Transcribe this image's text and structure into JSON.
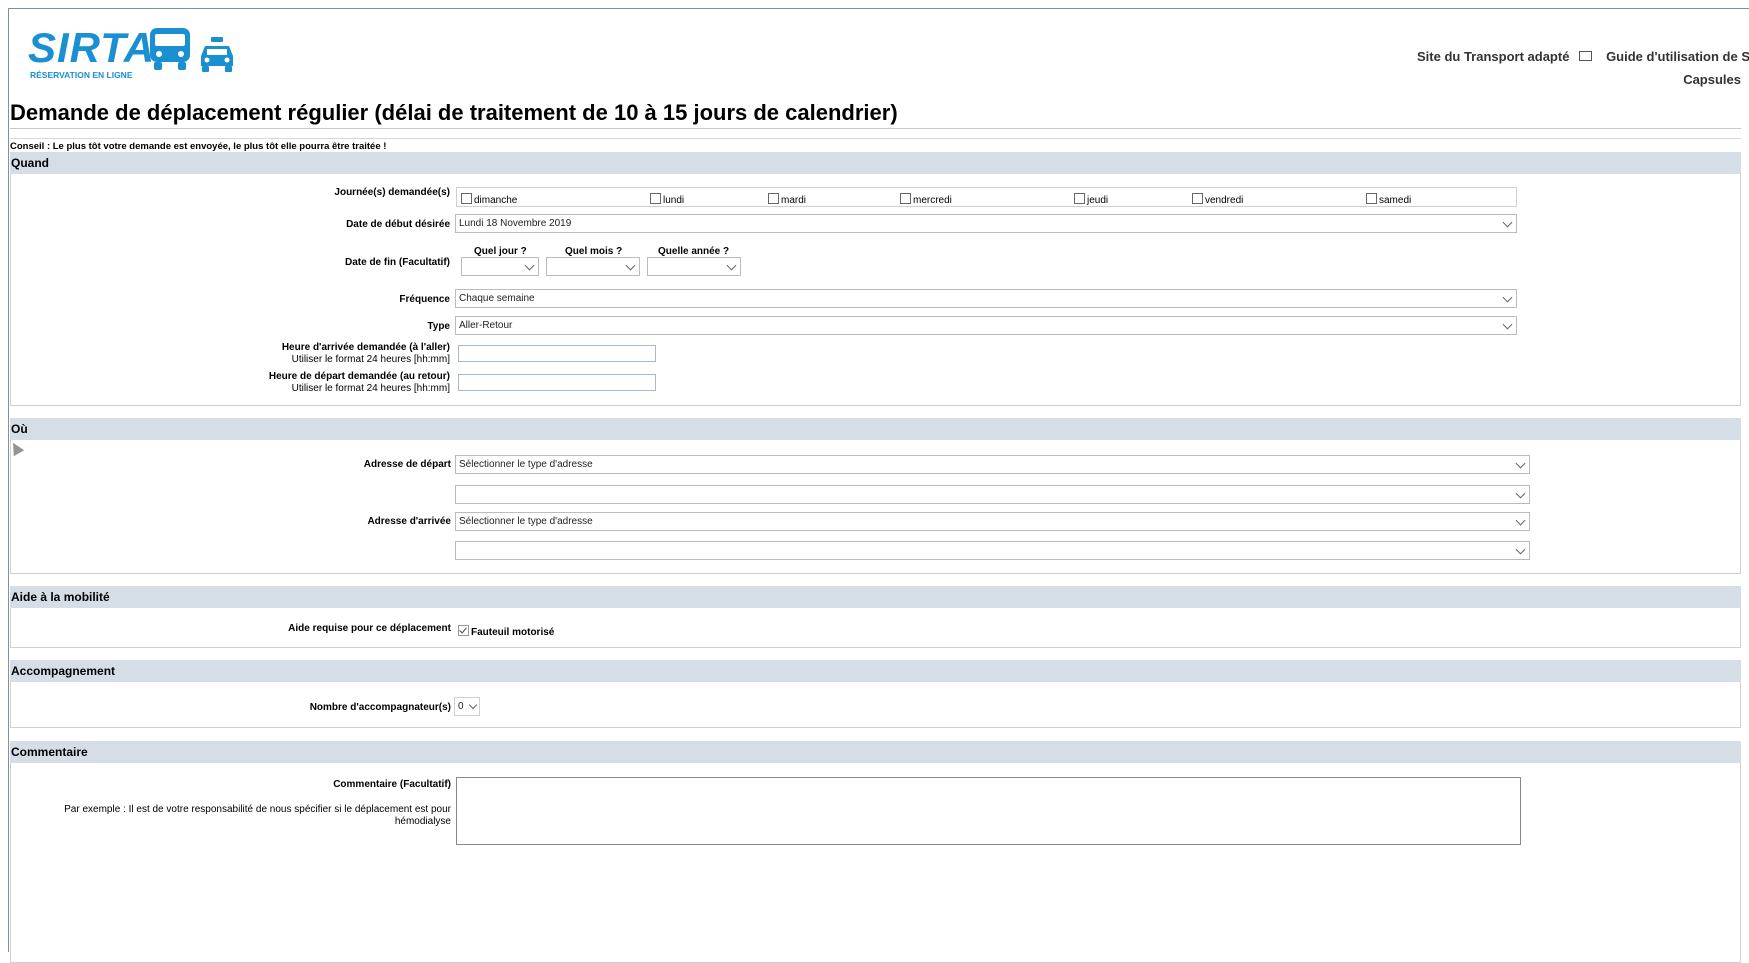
{
  "header": {
    "logo_text": "SIRTA",
    "logo_subtitle": "RÉSERVATION EN LIGNE",
    "link_transport": "Site du Transport adapté",
    "link_guide": "Guide d'utilisation de SIR",
    "link_capsules": "Capsules"
  },
  "page": {
    "title": "Demande de déplacement régulier (délai de traitement de 10 à 15 jours de calendrier)",
    "conseil": "Conseil : Le plus tôt votre demande est envoyée, le plus tôt elle pourra être traitée !"
  },
  "quand": {
    "header": "Quand",
    "days_label": "Journée(s) demandée(s)",
    "days": [
      "dimanche",
      "lundi",
      "mardi",
      "mercredi",
      "jeudi",
      "vendredi",
      "samedi"
    ],
    "start_label": "Date de début désirée",
    "start_value": "Lundi 18 Novembre 2019",
    "end_label": "Date de fin (Facultatif)",
    "col_day": "Quel jour ?",
    "col_month": "Quel mois ?",
    "col_year": "Quelle année ?",
    "freq_label": "Fréquence",
    "freq_value": "Chaque semaine",
    "type_label": "Type",
    "type_value": "Aller-Retour",
    "arrival_label": "Heure d'arrivée demandée (à l'aller)",
    "arrival_sub": "Utiliser le format 24 heures [hh:mm]",
    "departure_label": "Heure de départ demandée (au retour)",
    "departure_sub": "Utiliser le format 24 heures [hh:mm]"
  },
  "ou": {
    "header": "Où",
    "depart_label": "Adresse de départ",
    "depart_value": "Sélectionner le type d'adresse",
    "arrivee_label": "Adresse d'arrivée",
    "arrivee_value": "Sélectionner le type d'adresse"
  },
  "aide": {
    "header": "Aide à la mobilité",
    "label": "Aide requise pour ce déplacement",
    "option": "Fauteuil motorisé"
  },
  "accomp": {
    "header": "Accompagnement",
    "label": "Nombre d'accompagnateur(s)",
    "value": "0"
  },
  "commentaire": {
    "header": "Commentaire",
    "label": "Commentaire (Facultatif)",
    "example_line1": "Par exemple : Il est de votre responsabilité de nous spécifier si le déplacement est pour",
    "example_line2": "hémodialyse"
  },
  "colors": {
    "brand": "#1a8fd2",
    "section_bar": "#d5dee7"
  }
}
